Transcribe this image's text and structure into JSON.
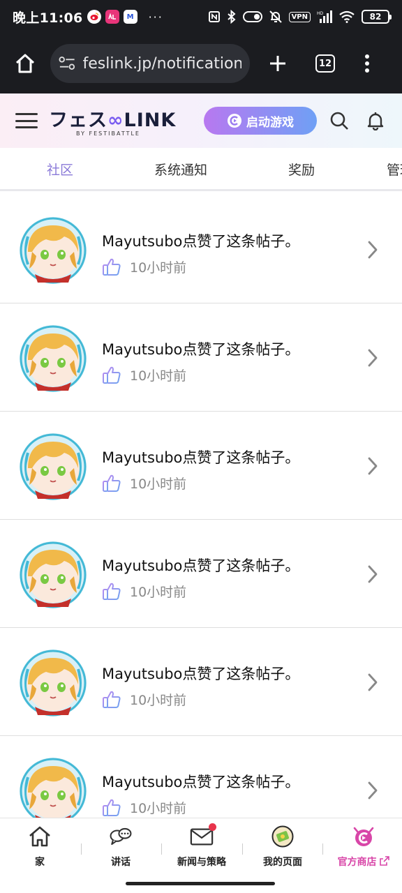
{
  "status_bar": {
    "time": "晚上11:06",
    "app_m_letter": "M",
    "more": "···",
    "vpn": "VPN",
    "battery": "82"
  },
  "browser": {
    "url": "feslink.jp/notifications",
    "tab_count": "12"
  },
  "header": {
    "logo_prefix": "フェス",
    "logo_suffix": "LINK",
    "logo_sub": "BY FESTIBATTLE",
    "launch_label": "启动游戏"
  },
  "tabs": [
    {
      "label": "社区",
      "active": true
    },
    {
      "label": "系统通知",
      "active": false
    },
    {
      "label": "奖励",
      "active": false
    },
    {
      "label": "管理",
      "active": false
    }
  ],
  "notifications": [
    {
      "text": "Mayutsubo点赞了这条帖子。",
      "time": "10小时前"
    },
    {
      "text": "Mayutsubo点赞了这条帖子。",
      "time": "10小时前"
    },
    {
      "text": "Mayutsubo点赞了这条帖子。",
      "time": "10小时前"
    },
    {
      "text": "Mayutsubo点赞了这条帖子。",
      "time": "10小时前"
    },
    {
      "text": "Mayutsubo点赞了这条帖子。",
      "time": "10小时前"
    },
    {
      "text": "Mayutsubo点赞了这条帖子。",
      "time": "10小时前"
    }
  ],
  "bottom_nav": [
    {
      "label": "家",
      "icon": "home-icon"
    },
    {
      "label": "讲话",
      "icon": "chat-icon"
    },
    {
      "label": "新闻与策略",
      "icon": "mail-icon",
      "badge": true
    },
    {
      "label": "我的页面",
      "icon": "profile-avatar-icon"
    },
    {
      "label": "官方商店",
      "icon": "shop-icon",
      "external": true
    }
  ],
  "colors": {
    "accent": "#8a7ad8",
    "shop": "#d846a8",
    "badge": "#e8344c",
    "avatar_ring": "#43b9d6"
  }
}
